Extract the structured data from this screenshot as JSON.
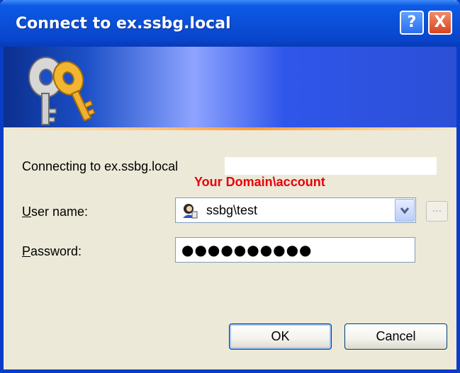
{
  "window": {
    "title": "Connect to ex.ssbg.local"
  },
  "title_buttons": {
    "help": "?",
    "close": "X"
  },
  "banner": {
    "icon": "keys-icon"
  },
  "content": {
    "connecting_text": "Connecting to ex.ssbg.local",
    "annotation": "Your Domain\\account",
    "annotation_color": "#e8000a",
    "username": {
      "label_prefix": "U",
      "label_rest": "ser name:",
      "value": "ssbg\\test",
      "icon": "user-icon"
    },
    "browse_label": "...",
    "password": {
      "label_prefix": "P",
      "label_rest": "assword:",
      "value": "●●●●●●●●●●"
    }
  },
  "buttons": {
    "ok": "OK",
    "cancel": "Cancel"
  }
}
